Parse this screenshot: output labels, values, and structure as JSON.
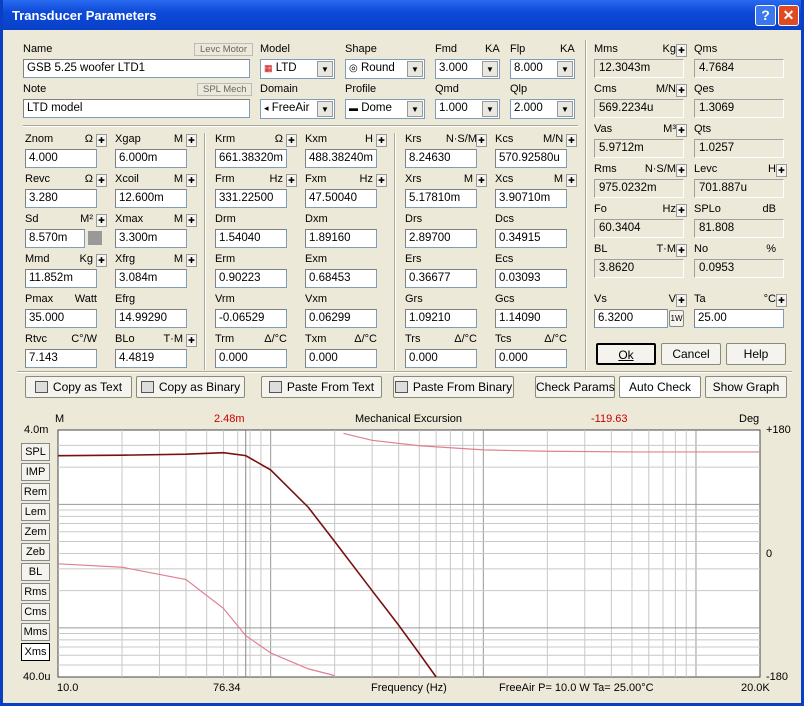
{
  "window": {
    "title": "Transducer Parameters"
  },
  "name": {
    "label": "Name",
    "tag": "Levc Motor",
    "value": "GSB 5.25 woofer LTD1"
  },
  "note": {
    "label": "Note",
    "tag": "SPL Mech",
    "value": "LTD model"
  },
  "model": {
    "label": "Model",
    "value": "LTD"
  },
  "shape": {
    "label": "Shape",
    "value": "Round"
  },
  "fmd": {
    "label": "Fmd",
    "unit": "KA",
    "value": "3.000"
  },
  "flp": {
    "label": "Flp",
    "unit": "KA",
    "value": "8.000"
  },
  "domain": {
    "label": "Domain",
    "value": "FreeAir"
  },
  "profile": {
    "label": "Profile",
    "value": "Dome"
  },
  "qmd": {
    "label": "Qmd",
    "value": "1.000"
  },
  "qlp": {
    "label": "Qlp",
    "value": "2.000"
  },
  "params": {
    "znom": {
      "label": "Znom",
      "unit": "Ω",
      "value": "4.000"
    },
    "xgap": {
      "label": "Xgap",
      "unit": "M",
      "value": "6.000m"
    },
    "revc": {
      "label": "Revc",
      "unit": "Ω",
      "value": "3.280"
    },
    "xcoil": {
      "label": "Xcoil",
      "unit": "M",
      "value": "12.600m"
    },
    "sd": {
      "label": "Sd",
      "unit": "M²",
      "value": "8.570m"
    },
    "xmax": {
      "label": "Xmax",
      "unit": "M",
      "value": "3.300m"
    },
    "mmd": {
      "label": "Mmd",
      "unit": "Kg",
      "value": "11.852m"
    },
    "xfrg": {
      "label": "Xfrg",
      "unit": "M",
      "value": "3.084m"
    },
    "pmax": {
      "label": "Pmax",
      "unit": "Watt",
      "value": "35.000"
    },
    "efrg": {
      "label": "Efrg",
      "value": "14.99290"
    },
    "rtvc": {
      "label": "Rtvc",
      "unit": "C°/W",
      "value": "7.143"
    },
    "blo": {
      "label": "BLo",
      "unit": "T·M",
      "value": "4.4819"
    },
    "krm": {
      "label": "Krm",
      "unit": "Ω",
      "value": "661.38320m"
    },
    "kxm": {
      "label": "Kxm",
      "unit": "H",
      "value": "488.38240m"
    },
    "frm": {
      "label": "Frm",
      "unit": "Hz",
      "value": "331.22500"
    },
    "fxm": {
      "label": "Fxm",
      "unit": "Hz",
      "value": "47.50040"
    },
    "drm": {
      "label": "Drm",
      "value": "1.54040"
    },
    "dxm": {
      "label": "Dxm",
      "value": "1.89160"
    },
    "erm": {
      "label": "Erm",
      "value": "0.90223"
    },
    "exm": {
      "label": "Exm",
      "value": "0.68453"
    },
    "vrm": {
      "label": "Vrm",
      "value": "-0.06529"
    },
    "vxm": {
      "label": "Vxm",
      "value": "0.06299"
    },
    "trm": {
      "label": "Trm",
      "unit": "Δ/°C",
      "value": "0.000"
    },
    "txm": {
      "label": "Txm",
      "unit": "Δ/°C",
      "value": "0.000"
    },
    "krs": {
      "label": "Krs",
      "unit": "N·S/M",
      "value": "8.24630"
    },
    "kcs": {
      "label": "Kcs",
      "unit": "M/N",
      "value": "570.92580u"
    },
    "xrs": {
      "label": "Xrs",
      "unit": "M",
      "value": "5.17810m"
    },
    "xcs": {
      "label": "Xcs",
      "unit": "M",
      "value": "3.90710m"
    },
    "drs": {
      "label": "Drs",
      "value": "2.89700"
    },
    "dcs": {
      "label": "Dcs",
      "value": "0.34915"
    },
    "ers": {
      "label": "Ers",
      "value": "0.36677"
    },
    "ecs": {
      "label": "Ecs",
      "value": "0.03093"
    },
    "grs": {
      "label": "Grs",
      "value": "1.09210"
    },
    "gcs": {
      "label": "Gcs",
      "value": "1.14090"
    },
    "trs": {
      "label": "Trs",
      "unit": "Δ/°C",
      "value": "0.000"
    },
    "tcs": {
      "label": "Tcs",
      "unit": "Δ/°C",
      "value": "0.000"
    }
  },
  "derived": {
    "mms": {
      "label": "Mms",
      "unit": "Kg",
      "value": "12.3043m"
    },
    "qms": {
      "label": "Qms",
      "value": "4.7684"
    },
    "cms": {
      "label": "Cms",
      "unit": "M/N",
      "value": "569.2234u"
    },
    "qes": {
      "label": "Qes",
      "value": "1.3069"
    },
    "vas": {
      "label": "Vas",
      "unit": "M³",
      "value": "5.9712m"
    },
    "qts": {
      "label": "Qts",
      "value": "1.0257"
    },
    "rms": {
      "label": "Rms",
      "unit": "N·S/M",
      "value": "975.0232m"
    },
    "levc": {
      "label": "Levc",
      "unit": "H",
      "value": "701.887u"
    },
    "fo": {
      "label": "Fo",
      "unit": "Hz",
      "value": "60.3404"
    },
    "splo": {
      "label": "SPLo",
      "unit": "dB",
      "value": "81.808"
    },
    "bl": {
      "label": "BL",
      "unit": "T·M",
      "value": "3.8620"
    },
    "no": {
      "label": "No",
      "unit": "%",
      "value": "0.0953"
    },
    "vs": {
      "label": "Vs",
      "unit": "V",
      "value": "6.3200",
      "btn": "1W"
    },
    "ta": {
      "label": "Ta",
      "unit": "°C",
      "value": "25.00"
    }
  },
  "buttons": {
    "ok": "Ok",
    "cancel": "Cancel",
    "help": "Help",
    "copy_text": "Copy as Text",
    "copy_binary": "Copy as Binary",
    "paste_text": "Paste From Text",
    "paste_binary": "Paste From Binary",
    "check_params": "Check Params",
    "auto_check": "Auto Check",
    "show_graph": "Show Graph"
  },
  "graph_buttons": [
    "SPL",
    "IMP",
    "Rem",
    "Lem",
    "Zem",
    "Zeb",
    "BL",
    "Rms",
    "Cms",
    "Mms",
    "Xms"
  ],
  "graph_selected": "Xms",
  "colors": {
    "curve_mag": "#7a1010",
    "curve_phase": "#e08090",
    "grid": "#bbbbbb",
    "cursor_val": "#cc0000"
  },
  "chart_data": {
    "type": "line",
    "title": "Mechanical Excursion",
    "xlabel": "Frequency (Hz)",
    "ylabel_left": "M",
    "ylabel_right": "Deg",
    "xscale": "log",
    "xlim": [
      10,
      20000
    ],
    "ylim_left": [
      4e-05,
      0.004
    ],
    "ylim_right": [
      -180,
      180
    ],
    "y_top_label": "4.0m",
    "y_bottom_label": "40.0u",
    "x_left_label": "10.0",
    "x_right_label": "20.0K",
    "y_right_ticks": [
      "+180",
      "0",
      "-180"
    ],
    "cursor_x_label": "76.34",
    "cursor_mag_readout": "2.48m",
    "cursor_phase_readout": "-119.63",
    "status": "FreeAir  P=  10.0 W  Ta=  25.00°C",
    "series": [
      {
        "name": "Excursion",
        "axis": "left",
        "x": [
          10,
          20,
          40,
          60,
          76.34,
          100,
          150,
          200,
          300,
          400,
          500,
          600
        ],
        "y": [
          0.00248,
          0.0025,
          0.00255,
          0.00262,
          0.00248,
          0.0019,
          0.00095,
          0.0005,
          0.0002,
          0.000105,
          6.2e-05,
          4e-05
        ]
      },
      {
        "name": "Phase",
        "axis": "right",
        "x": [
          10,
          20,
          40,
          60,
          76.34,
          100,
          150,
          200,
          220,
          300,
          500,
          1000,
          2000,
          5000,
          20000
        ],
        "y": [
          -15,
          -20,
          -38,
          -80,
          -119.63,
          -145,
          -168,
          -178,
          175,
          165,
          157,
          151,
          149,
          148,
          148
        ]
      }
    ]
  }
}
